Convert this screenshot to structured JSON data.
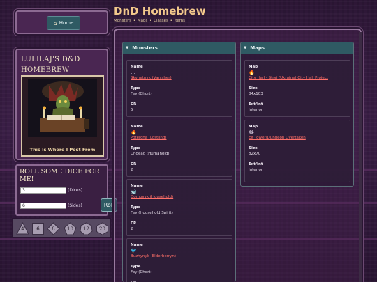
{
  "header": {
    "title": "DnD Homebrew",
    "nav": [
      "Monsters",
      "Maps",
      "Classes",
      "Items"
    ],
    "nav_separator": "•"
  },
  "sidebar": {
    "home_icon": "home-icon",
    "home_label": "Home",
    "profile_title": "LULILAJ'S D&D HOMEBREW",
    "portrait_caption": "This Is Where I Post From"
  },
  "dice_roller": {
    "title": "ROLL SOME DICE FOR ME!",
    "count_value": "3",
    "count_label": "(Dices)",
    "sides_value": "6",
    "sides_label": "(Sides)",
    "roll_label": "Roll",
    "dice": [
      "4",
      "6",
      "8",
      "10",
      "12",
      "20"
    ]
  },
  "monsters_panel": {
    "title": "Monsters",
    "labels": {
      "name": "Name",
      "type": "Type",
      "cr": "CR"
    },
    "items": [
      {
        "icon": "…",
        "name": "Skvhetnyk (Vanisher)",
        "type": "Fey (Chort)",
        "cr": "5"
      },
      {
        "icon": "🔥",
        "name": "Potercha (Lostling)",
        "type": "Undead (Humanoid)",
        "cr": "2"
      },
      {
        "icon": "🐋",
        "name": "Domovyk (Household)",
        "type": "Fey (Household Spirit)",
        "cr": "2"
      },
      {
        "icon": "🐦",
        "name": "Buzhynyk (Elderberryn)",
        "type": "Fey (Chort)",
        "cr": ""
      }
    ]
  },
  "maps_panel": {
    "title": "Maps",
    "labels": {
      "map": "Map",
      "size": "Size",
      "ext": "Ext/Int"
    },
    "items": [
      {
        "icon": "🔥",
        "name": "City Hall - Stryi (Ukraine) City Hall Project",
        "size": "84x103",
        "ext": "Interior"
      },
      {
        "icon": "😂",
        "name": "Elf Tower/Dungeon Overtaken",
        "size": "82x70",
        "ext": "Interior"
      }
    ]
  },
  "colors": {
    "accent_title": "#f3c98c",
    "panel_header": "#2f5a63",
    "link": "#ff6f68",
    "background": "#2a1533"
  }
}
